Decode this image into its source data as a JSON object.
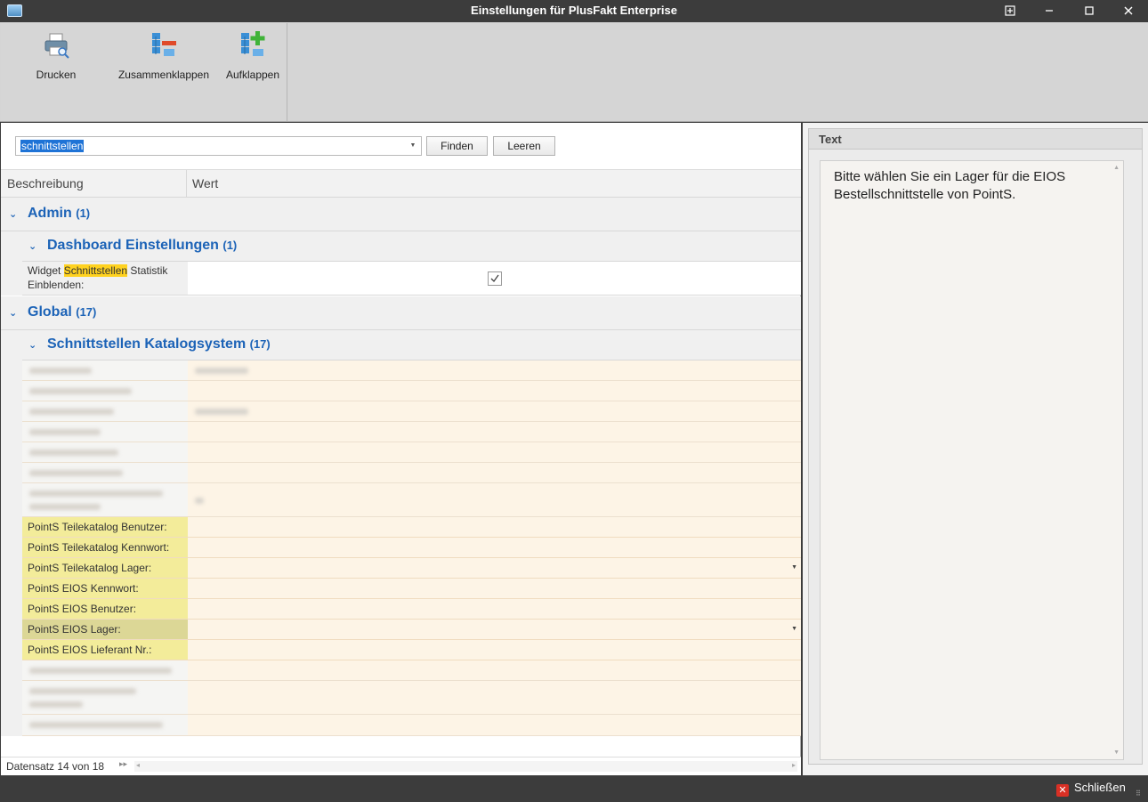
{
  "window": {
    "title": "Einstellungen für PlusFakt Enterprise",
    "buttons": [
      "restore",
      "minimize",
      "maximize",
      "close"
    ]
  },
  "ribbon": {
    "buttons": [
      {
        "label": "Drucken",
        "icon": "printer-icon"
      },
      {
        "label": "Zusammenklappen",
        "icon": "collapse-tree-icon"
      },
      {
        "label": "Aufklappen",
        "icon": "expand-tree-icon"
      }
    ]
  },
  "search": {
    "value": "schnittstellen",
    "find_label": "Finden",
    "clear_label": "Leeren"
  },
  "grid": {
    "columns": [
      "Beschreibung",
      "Wert"
    ],
    "groups": [
      {
        "title": "Admin",
        "count": "(1)",
        "subgroups": [
          {
            "title": "Dashboard Einstellungen",
            "count": "(1)",
            "rows": [
              {
                "label_parts": [
                  "Widget ",
                  "Schnittstellen",
                  " Statistik"
                ],
                "label_line2": "Einblenden:",
                "value": "checked"
              }
            ]
          }
        ]
      },
      {
        "title": "Global",
        "count": "(17)",
        "subgroups": [
          {
            "title": "Schnittstellen Katalogsystem",
            "count": "(17)",
            "rows": [
              {
                "label": "PointS Teilekatalog Benutzer:",
                "value": ""
              },
              {
                "label": "PointS Teilekatalog Kennwort:",
                "value": ""
              },
              {
                "label": "PointS Teilekatalog Lager:",
                "value": "",
                "dropdown": true
              },
              {
                "label": "PointS EIOS Kennwort:",
                "value": ""
              },
              {
                "label": "PointS EIOS Benutzer:",
                "value": ""
              },
              {
                "label": "PointS EIOS Lager:",
                "value": "",
                "dropdown": true,
                "selected": true
              },
              {
                "label": "PointS EIOS Lieferant Nr.:",
                "value": ""
              }
            ]
          }
        ]
      }
    ]
  },
  "navigator": {
    "record_text": "Datensatz 14 von 18"
  },
  "side_panel": {
    "header": "Text",
    "text": "Bitte wählen Sie ein Lager für die EIOS Bestellschnittstelle von PointS."
  },
  "footer": {
    "close_label": "Schließen"
  },
  "colors": {
    "group_blue": "#1c63b7",
    "highlight_yellow": "#ffd21f",
    "match_row_bg": "#f3ec9a",
    "value_bg": "#fdf4e6",
    "chrome_dark": "#3c3c3c"
  }
}
